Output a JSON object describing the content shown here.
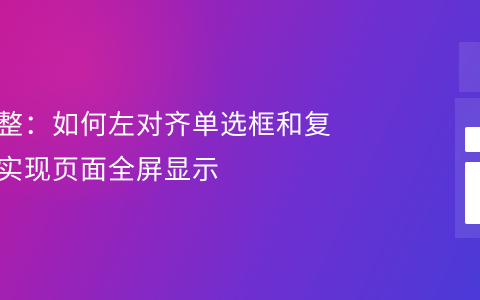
{
  "banner": {
    "title_line1": "整：如何左对齐单选框和复",
    "title_line2": "实现页面全屏显示",
    "gradient_colors": [
      "#c0199a",
      "#9a22b8",
      "#6f2fd0",
      "#4a3ad8"
    ],
    "decoration_icon": "info-icon"
  }
}
